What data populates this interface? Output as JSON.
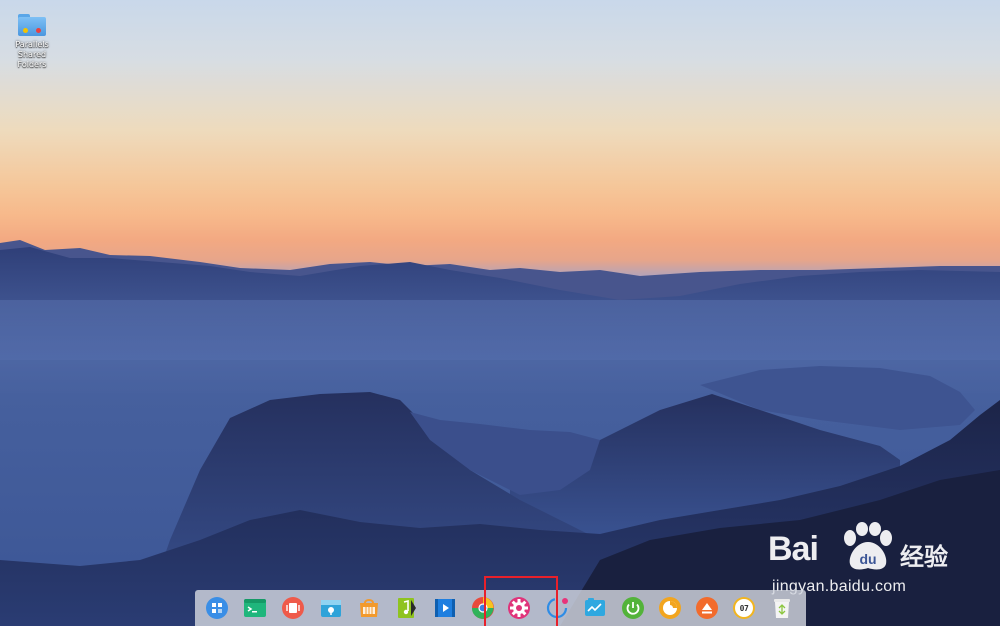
{
  "desktop": {
    "icons": [
      {
        "label": "Parallels Shared Folders",
        "icon": "folder-icon"
      }
    ]
  },
  "watermark": {
    "brand_left": "Bai",
    "brand_right": "经验",
    "url": "jingyan.baidu.com"
  },
  "dock": {
    "items": [
      {
        "name": "launcher",
        "icon": "launcher-icon",
        "color": "#3a8ee6"
      },
      {
        "name": "terminal",
        "icon": "terminal-icon",
        "color": "#1fb67c"
      },
      {
        "name": "multitask",
        "icon": "multitask-icon",
        "color": "#ef5a4a"
      },
      {
        "name": "file-manager",
        "icon": "file-manager-icon",
        "color": "#2fa3d9"
      },
      {
        "name": "app-store",
        "icon": "app-store-icon",
        "color": "#f39a2c"
      },
      {
        "name": "music",
        "icon": "music-icon",
        "color": "#8fc31f"
      },
      {
        "name": "video",
        "icon": "video-icon",
        "color": "#1f7fe0"
      },
      {
        "name": "chrome",
        "icon": "chrome-icon",
        "color": "#e84a3c"
      },
      {
        "name": "settings",
        "icon": "settings-icon",
        "color": "#e0337a"
      },
      {
        "name": "screenshot",
        "icon": "screenshot-icon",
        "color": "#2e8ce6"
      },
      {
        "name": "system-monitor",
        "icon": "system-monitor-icon",
        "color": "#2fa8e0"
      },
      {
        "name": "power",
        "icon": "power-icon",
        "color": "#53b33a"
      },
      {
        "name": "browser",
        "icon": "browser-icon",
        "color": "#f2a51f"
      },
      {
        "name": "installer",
        "icon": "installer-icon",
        "color": "#f26b2c"
      },
      {
        "name": "clock",
        "icon": "clock-icon",
        "color": "#f2b51f",
        "text": "07"
      },
      {
        "name": "trash",
        "icon": "trash-icon",
        "color": "#8cc63f"
      }
    ]
  }
}
